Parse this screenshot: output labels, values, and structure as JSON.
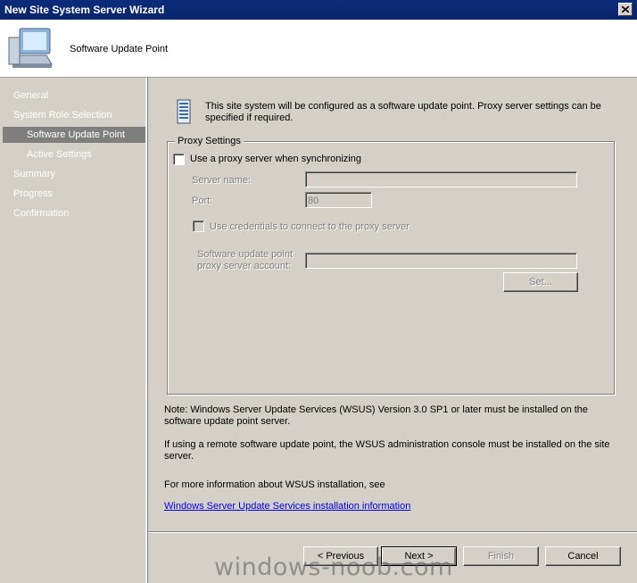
{
  "window": {
    "title": "New Site System Server Wizard"
  },
  "header": {
    "page_heading": "Software Update Point"
  },
  "sidebar": {
    "items": [
      {
        "label": "General"
      },
      {
        "label": "System Role Selection"
      },
      {
        "label": "Software Update Point",
        "selected": true
      },
      {
        "label": "Active Settings"
      },
      {
        "label": "Summary"
      },
      {
        "label": "Progress"
      },
      {
        "label": "Confirmation"
      }
    ]
  },
  "main": {
    "info_text": "This site system will be configured as a software update point. Proxy server settings can be specified if required.",
    "proxy_group": {
      "legend": "Proxy Settings",
      "use_proxy_label": "Use a proxy server when synchronizing",
      "use_proxy_checked": false,
      "server_name_label": "Server name:",
      "server_name_value": "",
      "port_label": "Port:",
      "port_value": "80",
      "use_credentials_label": "Use credentials to connect to the proxy server",
      "use_credentials_checked": false,
      "account_label_line1": "Software update point",
      "account_label_line2": "proxy server account:",
      "account_value": "",
      "set_button": "Set..."
    },
    "note1": "Note: Windows Server Update Services (WSUS) Version 3.0 SP1 or later must be installed on the software update point server.",
    "note2": "If using a remote software update point, the WSUS administration console must be installed on the site server.",
    "note3": "For more information about WSUS installation, see",
    "link": "Windows Server Update Services installation information"
  },
  "footer": {
    "previous": "< Previous",
    "next": "Next >",
    "finish": "Finish",
    "cancel": "Cancel"
  },
  "watermark": "windows-noob.com",
  "colors": {
    "title_bar": "#0a246a",
    "selected_nav": "#7f7f7f",
    "link": "#0000ee"
  }
}
